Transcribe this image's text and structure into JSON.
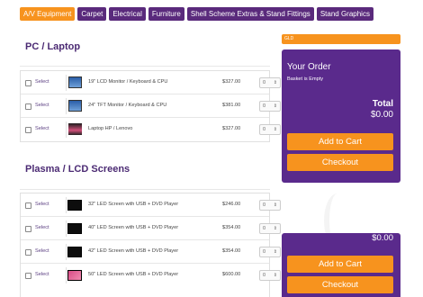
{
  "tabs": [
    {
      "label": "A/V Equipment",
      "active": true
    },
    {
      "label": "Carpet",
      "active": false
    },
    {
      "label": "Electrical",
      "active": false
    },
    {
      "label": "Furniture",
      "active": false
    },
    {
      "label": "Shell Scheme Extras & Stand Fittings",
      "active": false
    },
    {
      "label": "Stand Graphics",
      "active": false
    }
  ],
  "sections": {
    "pc": {
      "title": "PC / Laptop",
      "rows": [
        {
          "select": "Select",
          "image": "monitor-pc",
          "description": "19\" LCD Monitor / Keyboard & CPU",
          "price": "$327.00",
          "qty": "0"
        },
        {
          "select": "Select",
          "image": "monitor-pc",
          "description": "24\" TFT Monitor / Keyboard & CPU",
          "price": "$381.00",
          "qty": "0"
        },
        {
          "select": "Select",
          "image": "laptop",
          "description": "Laptop HP / Lenovo",
          "price": "$327.00",
          "qty": "0"
        }
      ]
    },
    "tv": {
      "title": "Plasma / LCD Screens",
      "rows": [
        {
          "select": "Select",
          "image": "tv",
          "description": "32\" LED Screen with USB + DVD Player",
          "price": "$246.00",
          "qty": "0"
        },
        {
          "select": "Select",
          "image": "tv",
          "description": "40\" LED Screen with USB + DVD Player",
          "price": "$354.00",
          "qty": "0"
        },
        {
          "select": "Select",
          "image": "tv",
          "description": "42\" LED Screen with USB + DVD Player",
          "price": "$354.00",
          "qty": "0"
        },
        {
          "select": "Select",
          "image": "tv",
          "description": "50\" LED Screen with USB + DVD Player",
          "price": "$600.00",
          "qty": "0"
        }
      ]
    }
  },
  "order": {
    "badge": "GLD",
    "title": "Your Order",
    "basket_status": "Basket is Empty",
    "total_label": "Total",
    "total_value": "$0.00",
    "add_to_cart": "Add to Cart",
    "checkout": "Checkout"
  },
  "order_sticky": {
    "total_value": "$0.00",
    "add_to_cart": "Add to Cart",
    "checkout": "Checkout"
  },
  "colors": {
    "accent": "#f7931e",
    "brand": "#5a2a8c"
  }
}
